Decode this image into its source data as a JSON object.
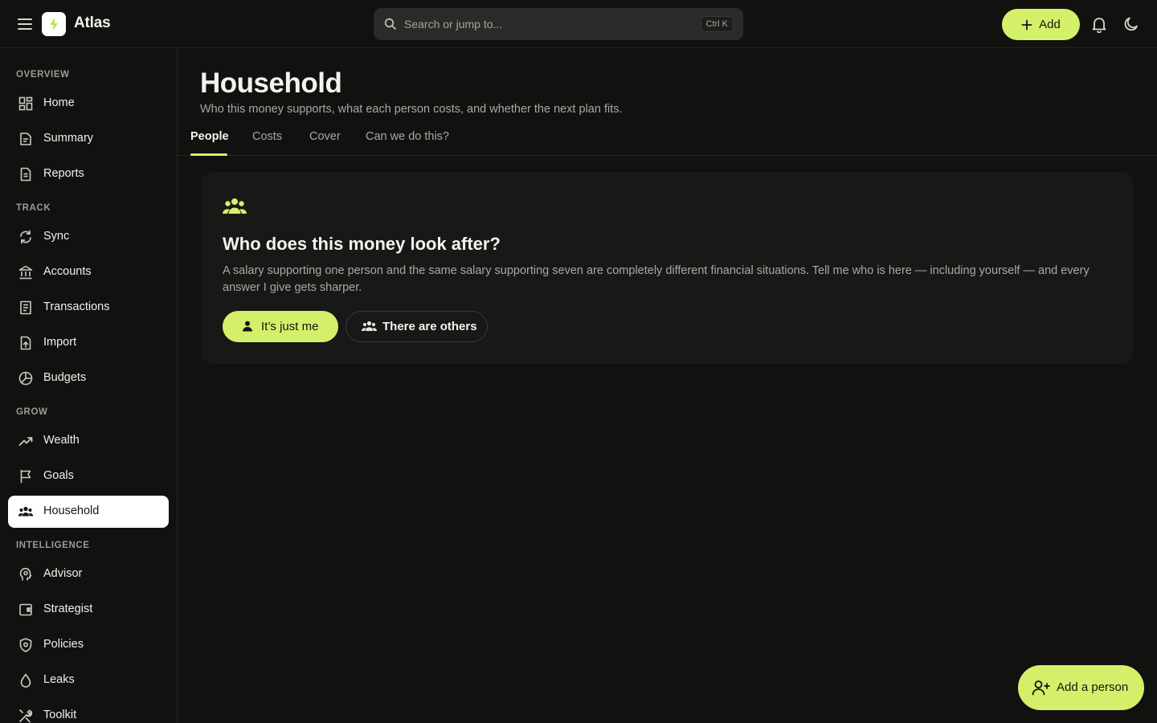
{
  "app": {
    "name": "Atlas"
  },
  "search": {
    "placeholder": "Search or jump to...",
    "shortcut": "Ctrl K"
  },
  "header": {
    "add_label": "Add"
  },
  "sidebar": {
    "sections": [
      {
        "label": "OVERVIEW",
        "items": [
          {
            "label": "Home",
            "icon": "dashboard-icon"
          },
          {
            "label": "Summary",
            "icon": "document-icon"
          },
          {
            "label": "Reports",
            "icon": "report-icon"
          }
        ]
      },
      {
        "label": "TRACK",
        "items": [
          {
            "label": "Sync",
            "icon": "sync-icon"
          },
          {
            "label": "Accounts",
            "icon": "bank-icon"
          },
          {
            "label": "Transactions",
            "icon": "receipt-icon"
          },
          {
            "label": "Import",
            "icon": "file-upload-icon"
          },
          {
            "label": "Budgets",
            "icon": "pie-chart-icon"
          }
        ]
      },
      {
        "label": "GROW",
        "items": [
          {
            "label": "Wealth",
            "icon": "trending-up-icon"
          },
          {
            "label": "Goals",
            "icon": "flag-icon"
          },
          {
            "label": "Household",
            "icon": "people-icon",
            "active": true
          }
        ]
      },
      {
        "label": "INTELLIGENCE",
        "items": [
          {
            "label": "Advisor",
            "icon": "brain-icon"
          },
          {
            "label": "Strategist",
            "icon": "wallet-icon"
          },
          {
            "label": "Policies",
            "icon": "shield-icon"
          },
          {
            "label": "Leaks",
            "icon": "drop-icon"
          },
          {
            "label": "Toolkit",
            "icon": "tools-icon"
          }
        ]
      }
    ]
  },
  "main": {
    "title": "Household",
    "subtitle": "Who this money supports, what each person costs, and whether the next plan fits.",
    "tabs": [
      {
        "label": "People",
        "active": true
      },
      {
        "label": "Costs"
      },
      {
        "label": "Cover"
      },
      {
        "label": "Can we do this?"
      }
    ],
    "card": {
      "icon": "people-icon",
      "title": "Who does this money look after?",
      "text": "A salary supporting one person and the same salary supporting seven are completely different financial situations. Tell me who is here — including yourself — and every answer I give gets sharper.",
      "primary_label": "It’s just me",
      "secondary_label": "There are others"
    },
    "fab_label": "Add a person"
  },
  "colors": {
    "accent": "#d4f06a",
    "background": "#111110",
    "card": "#181817",
    "sidebar_active": "#ffffff"
  }
}
